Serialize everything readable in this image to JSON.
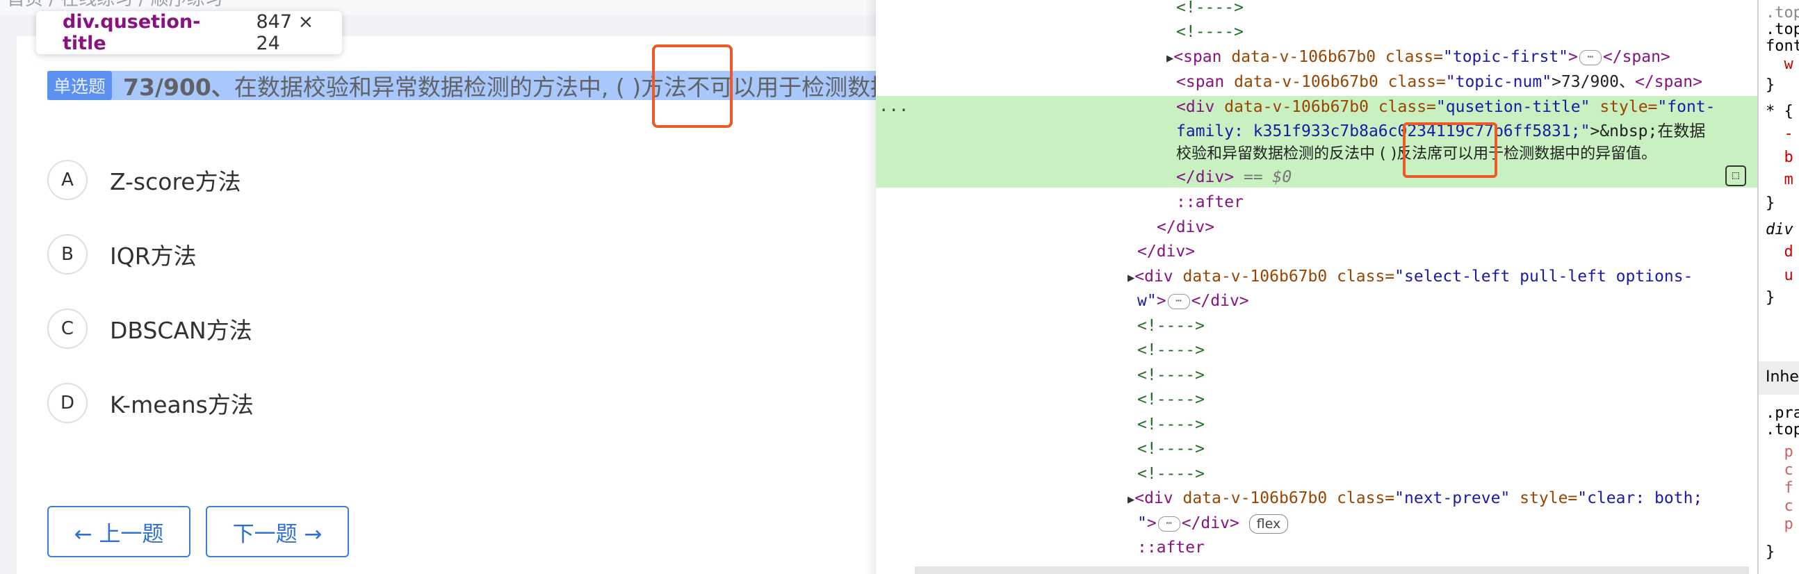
{
  "left": {
    "breadcrumb": "首页  /  在线练习  /  顺序练习",
    "tooltip": {
      "selector": "div.qusetion-title",
      "dimensions": "847 × 24"
    },
    "question": {
      "type_badge": "单选题",
      "number": "73/900、",
      "text": " 在数据校验和异常数据检测的方法中, ( )方法不可以用于检测数据中的异常值。"
    },
    "options": [
      {
        "letter": "A",
        "text": "Z-score方法"
      },
      {
        "letter": "B",
        "text": "IQR方法"
      },
      {
        "letter": "C",
        "text": "DBSCAN方法"
      },
      {
        "letter": "D",
        "text": "K-means方法"
      }
    ],
    "buttons": {
      "prev": "← 上一题",
      "next": "下一题 →"
    }
  },
  "devtools": {
    "comment": "<!---->",
    "line_span_first": {
      "open": "<span ",
      "attr1": "data-v-106b67b0",
      "attr2": " class=",
      "val2": "\"topic-first\"",
      "close": "</span>"
    },
    "line_span_num": {
      "open": "<span ",
      "attr1": "data-v-106b67b0",
      "attr2": " class=",
      "val2": "\"topic-num\"",
      "text": ">73/900、",
      "close": "</span>"
    },
    "line_div_title": {
      "open": "<div ",
      "attr1": "data-v-106b67b0",
      "attr2": " class=",
      "val2": "\"qusetion-title\"",
      "attr3": " style=",
      "val3": "\"font-"
    },
    "line_div_title_2": {
      "val": "family: k351f933c7b8a6c0234119c77b6ff5831;\"",
      "text": ">&nbsp;在数据"
    },
    "line_div_title_3": "校验和异留数据检测的反法中 ( )反法席可以用于检测数据中的异留值。",
    "line_div_close": "</div>",
    "dollar": "== $0",
    "after": "::after",
    "close_div": "</div>",
    "line_select_left": {
      "open": "<div ",
      "attr1": "data-v-106b67b0",
      "attr2": " class=",
      "val2": "\"select-left pull-left options-"
    },
    "line_select_left_2": {
      "val": "w\"",
      "close": "</div>"
    },
    "line_next_preve": {
      "open": "<div ",
      "attr1": "data-v-106b67b0",
      "attr2": " class=",
      "val2": "\"next-preve\"",
      "attr3": " style=",
      "val3": "\"clear: both;"
    },
    "line_next_preve_2": {
      "val": "\"",
      "close": "</div>",
      "badge": "flex"
    },
    "ellipsis": "⋯",
    "dots": "...",
    "styles": [
      ".top",
      ".top",
      "font",
      "  w",
      "}",
      "* {",
      "  -",
      "  b",
      "  m",
      "}",
      "div",
      "  d",
      "  u",
      "}",
      "Inhe",
      ".pra",
      ".top",
      "  p",
      "  c",
      "  f",
      "  c",
      "  p",
      "}"
    ]
  }
}
